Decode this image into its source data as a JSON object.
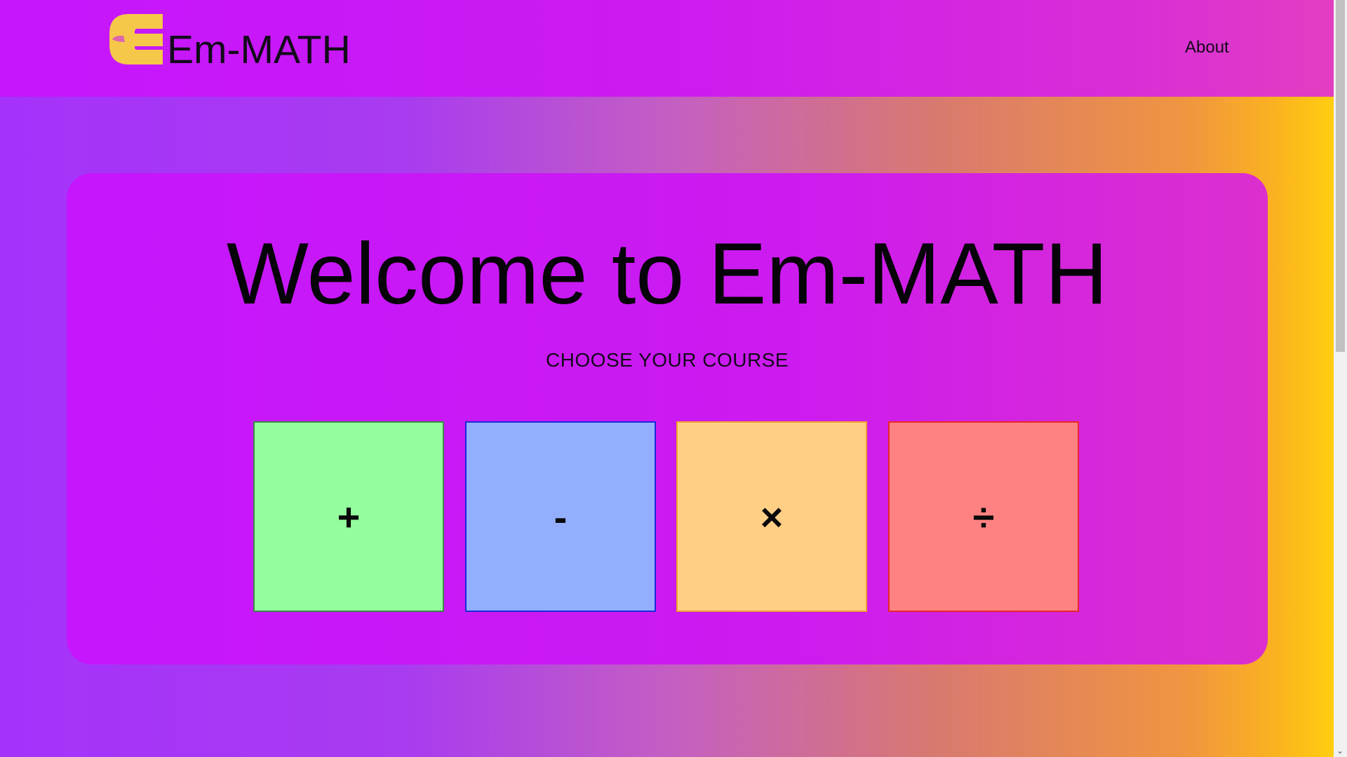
{
  "nav": {
    "brand": "Em-MATH",
    "links": [
      {
        "label": "About"
      }
    ]
  },
  "hero": {
    "title": "Welcome to Em-MATH",
    "subtitle": "CHOOSE YOUR COURSE"
  },
  "courses": [
    {
      "symbol": "+",
      "color": "#94fd9e"
    },
    {
      "symbol": "-",
      "color": "#94aefe"
    },
    {
      "symbol": "×",
      "color": "#ffcf86"
    },
    {
      "symbol": "÷",
      "color": "#ff8282"
    }
  ],
  "colors": {
    "header": "#c516fd",
    "logo": "#f5c84a",
    "background_start": "#a532fb",
    "background_end": "#ffd40d"
  }
}
